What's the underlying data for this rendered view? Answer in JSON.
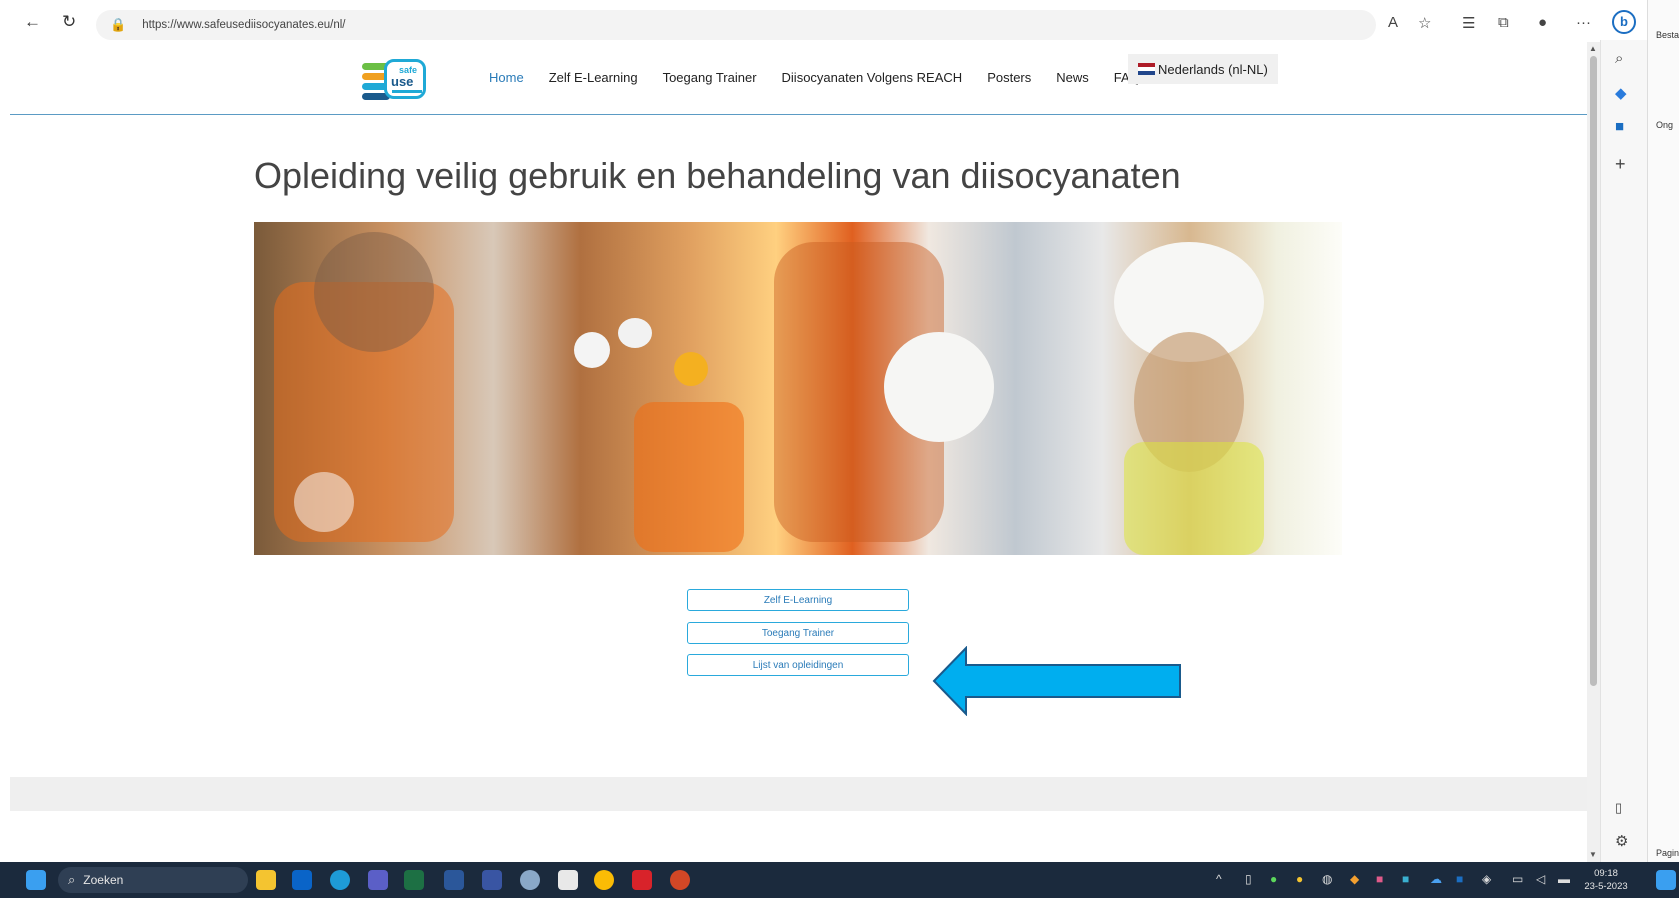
{
  "browser": {
    "url": "https://www.safeusediisocyanates.eu/nl/",
    "back_glyph": "←",
    "refresh_glyph": "↻",
    "more_glyph": "···"
  },
  "logo": {
    "line1": "safe",
    "line2": "use"
  },
  "nav": [
    {
      "label": "Home",
      "active": true
    },
    {
      "label": "Zelf E-Learning"
    },
    {
      "label": "Toegang Trainer"
    },
    {
      "label": "Diisocyanaten Volgens REACH"
    },
    {
      "label": "Posters"
    },
    {
      "label": "News"
    },
    {
      "label": "FAQ"
    }
  ],
  "language": {
    "label": "Nederlands (nl-NL)",
    "flag_colors": [
      "#ae1c28",
      "#ffffff",
      "#21468b"
    ]
  },
  "main": {
    "title": "Opleiding veilig gebruik en behandeling van diisocyanaten",
    "buttons": [
      "Zelf E-Learning",
      "Toegang Trainer",
      "Lijst van opleidingen"
    ]
  },
  "annotation": {
    "arrow_color": "#00aeef",
    "arrow_outline": "#1a5a8c"
  },
  "side_panel": {
    "text1": "Besta",
    "text2": "Ong",
    "text3": "Pagin"
  },
  "taskbar": {
    "search_label": "Zoeken",
    "time": "09:18",
    "date": "23-5-2023"
  }
}
